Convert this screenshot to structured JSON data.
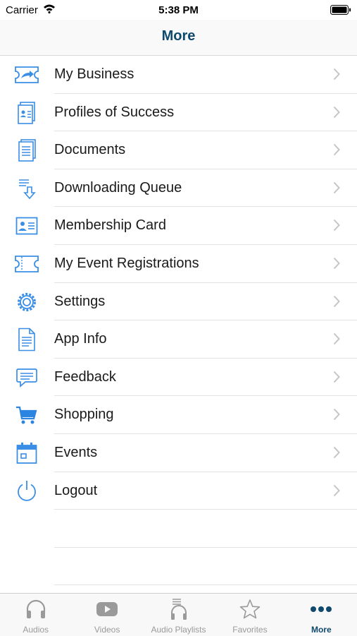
{
  "status_bar": {
    "carrier": "Carrier",
    "time": "5:38 PM"
  },
  "nav": {
    "title": "More"
  },
  "colors": {
    "accent": "#3a8ee6",
    "title": "#0f4a6e",
    "inactive": "#9a9a9a"
  },
  "menu": {
    "items": [
      {
        "label": "My Business",
        "icon": "ticket-arrow-icon"
      },
      {
        "label": "Profiles of Success",
        "icon": "profile-document-icon"
      },
      {
        "label": "Documents",
        "icon": "document-icon"
      },
      {
        "label": "Downloading Queue",
        "icon": "download-queue-icon"
      },
      {
        "label": "Membership Card",
        "icon": "id-card-icon"
      },
      {
        "label": "My Event Registrations",
        "icon": "ticket-icon"
      },
      {
        "label": "Settings",
        "icon": "gear-icon"
      },
      {
        "label": "App Info",
        "icon": "info-document-icon"
      },
      {
        "label": "Feedback",
        "icon": "chat-bubble-icon"
      },
      {
        "label": "Shopping",
        "icon": "cart-icon"
      },
      {
        "label": "Events",
        "icon": "calendar-icon"
      },
      {
        "label": "Logout",
        "icon": "power-icon"
      }
    ]
  },
  "tabs": [
    {
      "label": "Audios",
      "icon": "headphones-icon",
      "active": false
    },
    {
      "label": "Videos",
      "icon": "play-video-icon",
      "active": false
    },
    {
      "label": "Audio Playlists",
      "icon": "playlist-headphones-icon",
      "active": false
    },
    {
      "label": "Favorites",
      "icon": "star-icon",
      "active": false
    },
    {
      "label": "More",
      "icon": "more-dots-icon",
      "active": true
    }
  ]
}
